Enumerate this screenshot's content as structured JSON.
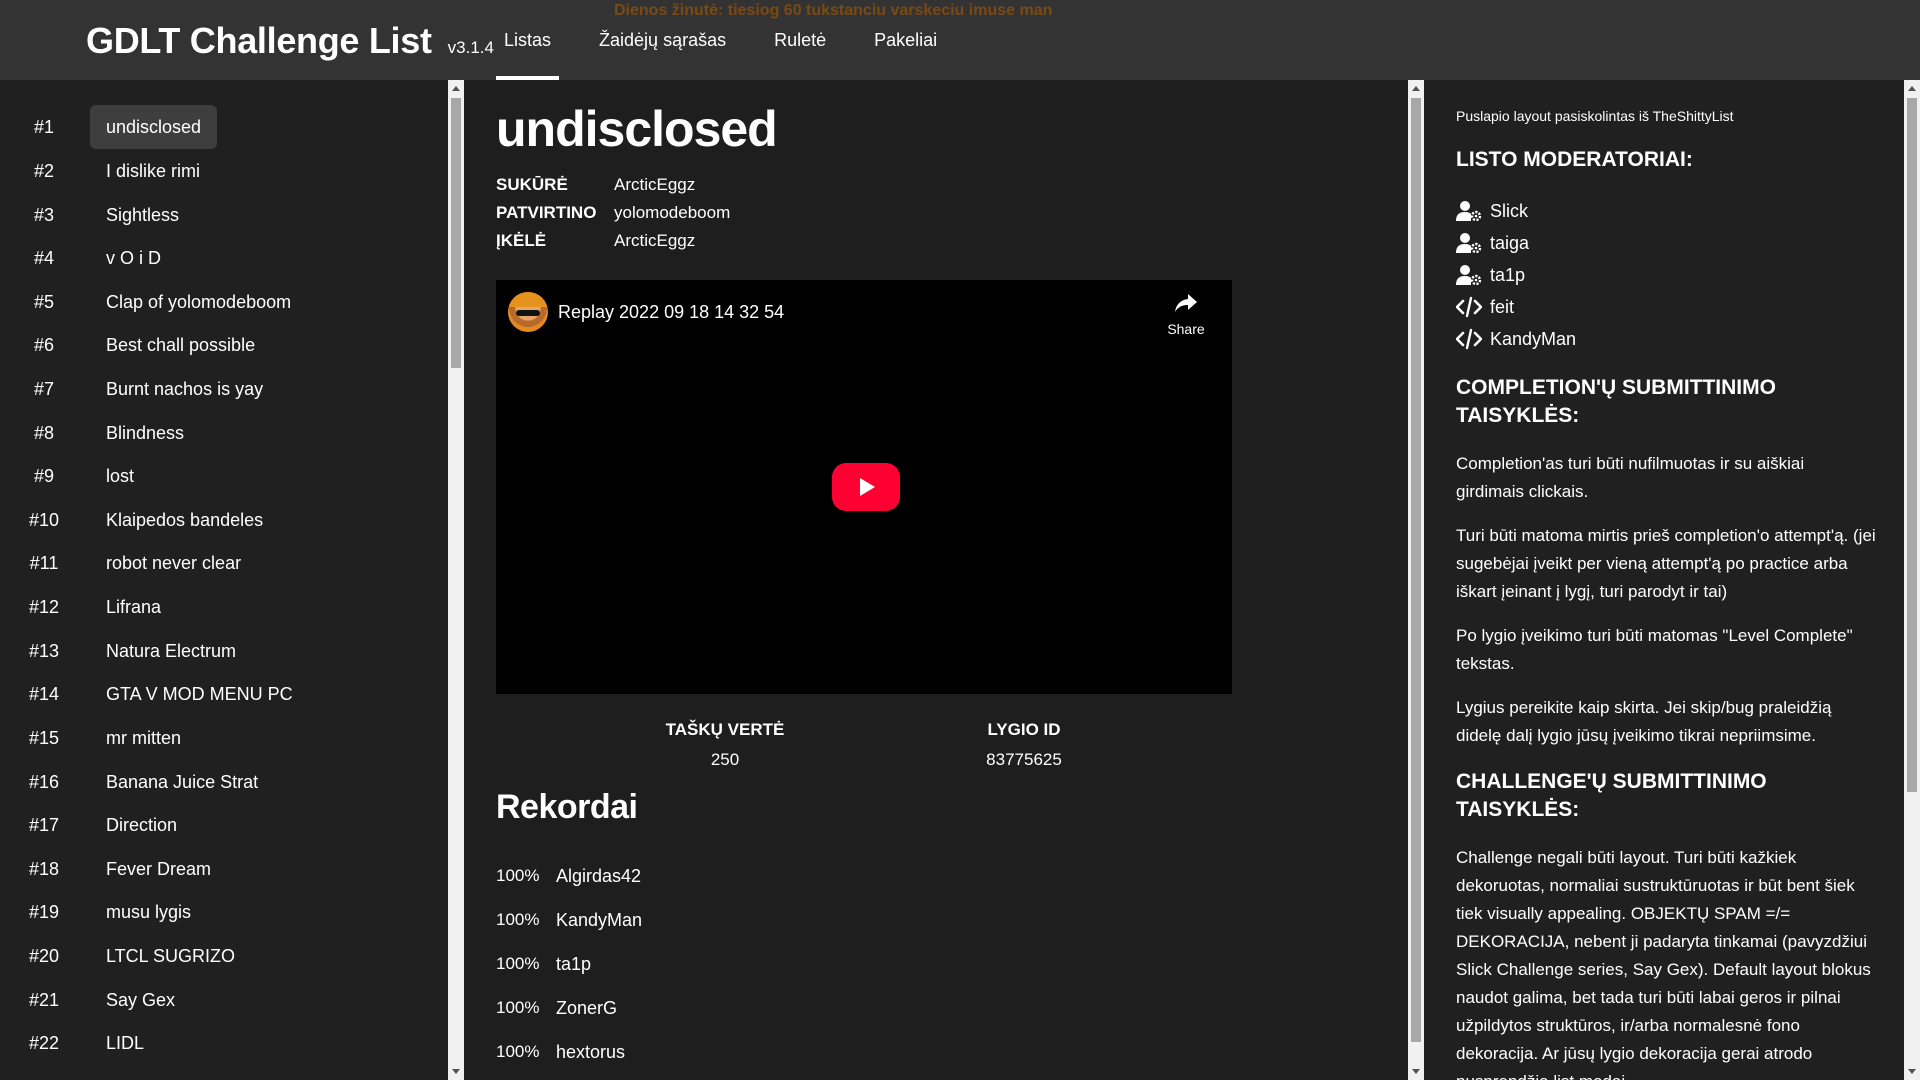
{
  "header": {
    "title": "GDLT Challenge List",
    "version": "v3.1.4",
    "daily_message": "Dienos žinutė: tiesiog 60 tukstanciu varskeciu imuse man",
    "tabs": [
      {
        "label": "Listas",
        "active": true
      },
      {
        "label": "Žaidėjų sąrašas",
        "active": false
      },
      {
        "label": "Ruletė",
        "active": false
      },
      {
        "label": "Pakeliai",
        "active": false
      }
    ]
  },
  "levels": [
    {
      "rank": "#1",
      "name": "undisclosed",
      "active": true
    },
    {
      "rank": "#2",
      "name": "I dislike rimi"
    },
    {
      "rank": "#3",
      "name": "Sightless"
    },
    {
      "rank": "#4",
      "name": "v O i D"
    },
    {
      "rank": "#5",
      "name": "Clap of yolomodeboom"
    },
    {
      "rank": "#6",
      "name": "Best chall possible"
    },
    {
      "rank": "#7",
      "name": "Burnt nachos is yay"
    },
    {
      "rank": "#8",
      "name": "Blindness"
    },
    {
      "rank": "#9",
      "name": "lost"
    },
    {
      "rank": "#10",
      "name": "Klaipedos bandeles"
    },
    {
      "rank": "#11",
      "name": "robot never clear"
    },
    {
      "rank": "#12",
      "name": "Lifrana"
    },
    {
      "rank": "#13",
      "name": "Natura Electrum"
    },
    {
      "rank": "#14",
      "name": "GTA V MOD MENU PC"
    },
    {
      "rank": "#15",
      "name": "mr mitten"
    },
    {
      "rank": "#16",
      "name": "Banana Juice Strat"
    },
    {
      "rank": "#17",
      "name": "Direction"
    },
    {
      "rank": "#18",
      "name": "Fever Dream"
    },
    {
      "rank": "#19",
      "name": "musu lygis"
    },
    {
      "rank": "#20",
      "name": "LTCL SUGRIZO"
    },
    {
      "rank": "#21",
      "name": "Say Gex"
    },
    {
      "rank": "#22",
      "name": "LIDL"
    }
  ],
  "level": {
    "title": "undisclosed",
    "meta": [
      {
        "label": "SUKŪRĖ",
        "value": "ArcticEggz"
      },
      {
        "label": "PATVIRTINO",
        "value": "yolomodeboom"
      },
      {
        "label": "ĮKĖLĖ",
        "value": "ArcticEggz"
      }
    ],
    "video": {
      "title": "Replay 2022 09 18 14 32 54",
      "share_label": "Share"
    },
    "points_label": "TAŠKŲ VERTĖ",
    "points_value": "250",
    "id_label": "LYGIO ID",
    "id_value": "83775625"
  },
  "records": {
    "title": "Rekordai",
    "rows": [
      {
        "percent": "100%",
        "player": "Algirdas42"
      },
      {
        "percent": "100%",
        "player": "KandyMan"
      },
      {
        "percent": "100%",
        "player": "ta1p"
      },
      {
        "percent": "100%",
        "player": "ZonerG"
      },
      {
        "percent": "100%",
        "player": "hextorus"
      }
    ]
  },
  "sidebar": {
    "credit": "Puslapio layout pasiskolintas iš TheShittyList",
    "moderators_title": "LISTO MODERATORIAI:",
    "moderators": [
      {
        "name": "Slick",
        "icon": "user-gear-icon"
      },
      {
        "name": "taiga",
        "icon": "user-gear-icon"
      },
      {
        "name": "ta1p",
        "icon": "user-gear-icon"
      },
      {
        "name": "feit",
        "icon": "code-icon"
      },
      {
        "name": "KandyMan",
        "icon": "code-icon"
      }
    ],
    "completion_title": "COMPLETION'Ų SUBMITTINIMO TAISYKLĖS:",
    "completion_rules": [
      "Completion'as turi būti nufilmuotas ir su aiškiai girdimais clickais.",
      "Turi būti matoma mirtis prieš completion'o attempt'ą. (jei sugebėjai įveikt per vieną attempt'ą po practice arba iškart įeinant į lygį, turi parodyt ir tai)",
      "Po lygio įveikimo turi būti matomas \"Level Complete\" tekstas.",
      "Lygius pereikite kaip skirta. Jei skip/bug praleidžią didelę dalį lygio jūsų įveikimo tikrai nepriimsime."
    ],
    "challenge_title": "CHALLENGE'Ų SUBMITTINIMO TAISYKLĖS:",
    "challenge_rules": [
      "Challenge negali būti layout. Turi būti kažkiek dekoruotas, normaliai sustruktūruotas ir būt bent šiek tiek visually appealing. OBJEKTŲ SPAM =/= DEKORACIJA, nebent ji padaryta tinkamai (pavyzdžiui Slick Challenge series, Say Gex). Default layout blokus naudot galima, bet tada turi būti labai geros ir pilnai užpildytos struktūros, ir/arba normalesnė fono dekoracija. Ar jūsų lygio dekoracija gerai atrodo nusprendžia list modai."
    ]
  }
}
